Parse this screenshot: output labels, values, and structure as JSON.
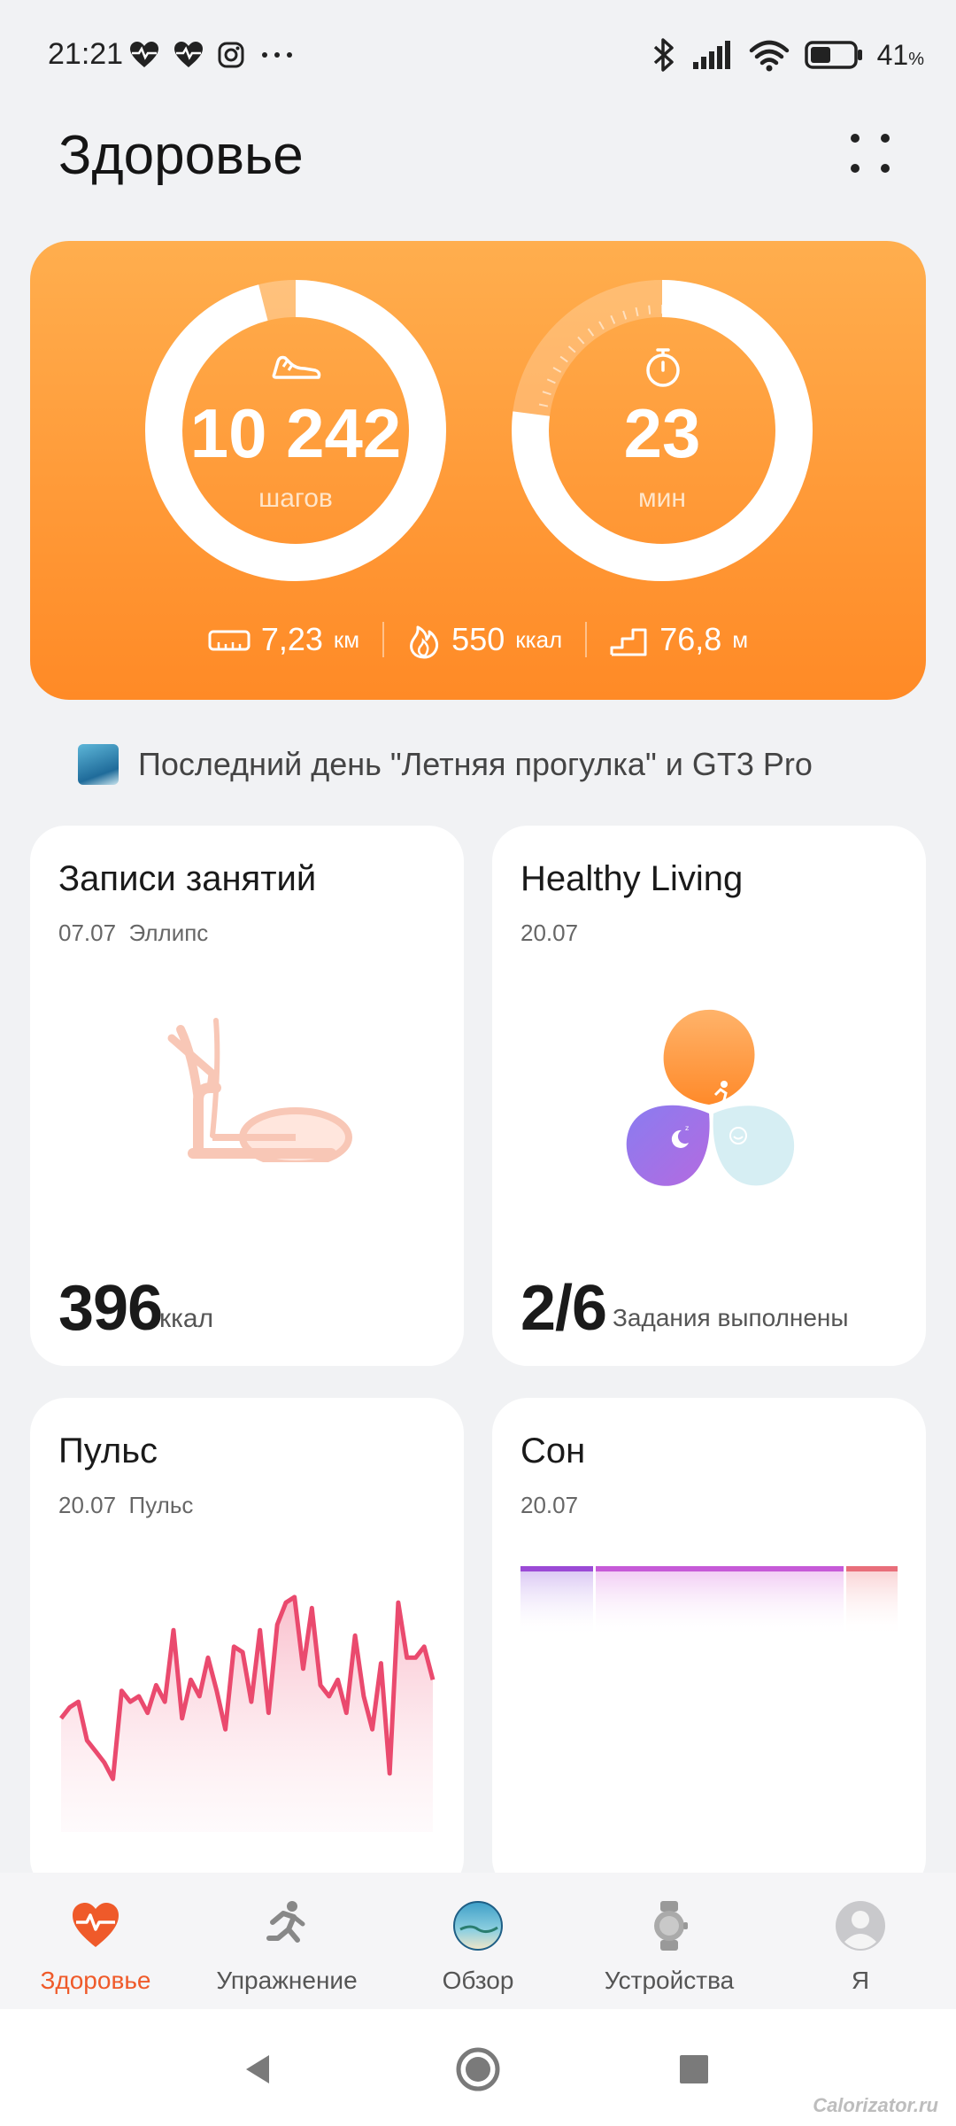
{
  "status_bar": {
    "time": "21:21",
    "left_icons": [
      "heart-pulse-icon",
      "heart-pulse-icon",
      "instagram-icon",
      "more-dots-icon"
    ],
    "right_icons": [
      "bluetooth-icon",
      "signal-icon",
      "wifi-icon",
      "battery-icon"
    ],
    "battery_percent": "41",
    "battery_unit": "%"
  },
  "header": {
    "title": "Здоровье",
    "menu_icon": "more-dots-2x2-icon"
  },
  "activity": {
    "steps": {
      "value": "10 242",
      "unit": "шагов",
      "progress": 0.96,
      "icon": "shoe-icon"
    },
    "minutes": {
      "value": "23",
      "unit": "мин",
      "progress": 0.77,
      "icon": "stopwatch-icon"
    },
    "stats": [
      {
        "icon": "ruler-icon",
        "value": "7,23",
        "unit": "км"
      },
      {
        "icon": "flame-icon",
        "value": "550",
        "unit": "ккал"
      },
      {
        "icon": "stairs-icon",
        "value": "76,8",
        "unit": "м"
      }
    ]
  },
  "promo": {
    "text": "Последний день \"Летняя прогулка\" и GT3 Pro"
  },
  "cards": {
    "workouts": {
      "title": "Записи занятий",
      "date": "07.07",
      "subtitle": "Эллипс",
      "value": "396",
      "unit": "ккал"
    },
    "healthy_living": {
      "title": "Healthy Living",
      "date": "20.07",
      "value": "2/6",
      "unit": "Задания выполнены"
    },
    "heart_rate": {
      "title": "Пульс",
      "date": "20.07",
      "subtitle": "Пульс"
    },
    "sleep": {
      "title": "Сон",
      "date": "20.07"
    }
  },
  "heart_series": [
    78,
    82,
    84,
    70,
    66,
    62,
    56,
    88,
    84,
    86,
    80,
    90,
    84,
    110,
    78,
    92,
    86,
    100,
    88,
    74,
    104,
    102,
    84,
    110,
    80,
    112,
    120,
    122,
    96,
    118,
    90,
    86,
    92,
    80,
    108,
    86,
    74,
    98,
    58,
    120,
    100,
    100,
    104,
    92
  ],
  "bottom_nav": [
    {
      "label": "Здоровье",
      "icon": "heart-pulse-icon",
      "active": true
    },
    {
      "label": "Упражнение",
      "icon": "running-person-icon",
      "active": false
    },
    {
      "label": "Обзор",
      "icon": "globe-icon",
      "active": false
    },
    {
      "label": "Устройства",
      "icon": "watch-icon",
      "active": false
    },
    {
      "label": "Я",
      "icon": "avatar-icon",
      "active": false
    }
  ],
  "system_nav": [
    "back-icon",
    "home-icon",
    "recents-icon"
  ],
  "watermark": "Calorizator.ru",
  "colors": {
    "accent": "#ef5a2a",
    "hero": "#ff9a38",
    "heart_line": "#ea4a6e",
    "sleep_deep": "#9b4ad6",
    "sleep_light": "#c65ad8",
    "sleep_rem": "#e86e7a"
  }
}
